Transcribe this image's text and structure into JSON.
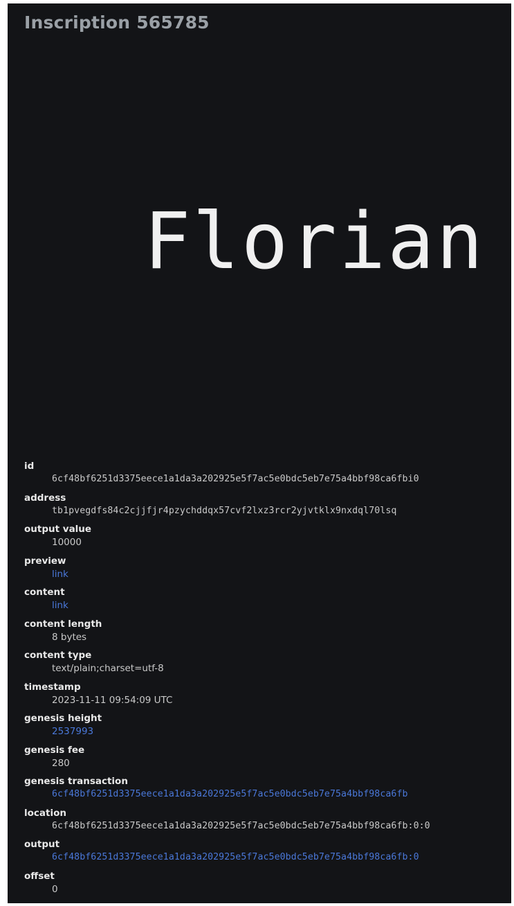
{
  "title": "Inscription 565785",
  "preview": {
    "content": "Florian"
  },
  "details": {
    "id": {
      "label": "id",
      "value": "6cf48bf6251d3375eece1a1da3a202925e5f7ac5e0bdc5eb7e75a4bbf98ca6fbi0"
    },
    "address": {
      "label": "address",
      "value": "tb1pvegdfs84c2cjjfjr4pzychddqx57cvf2lxz3rcr2yjvtklx9nxdql70lsq"
    },
    "output_value": {
      "label": "output value",
      "value": "10000"
    },
    "preview": {
      "label": "preview",
      "link_text": "link"
    },
    "content": {
      "label": "content",
      "link_text": "link"
    },
    "content_length": {
      "label": "content length",
      "value": "8 bytes"
    },
    "content_type": {
      "label": "content type",
      "value": "text/plain;charset=utf-8"
    },
    "timestamp": {
      "label": "timestamp",
      "value": "2023-11-11 09:54:09 UTC"
    },
    "genesis_height": {
      "label": "genesis height",
      "link_text": "2537993"
    },
    "genesis_fee": {
      "label": "genesis fee",
      "value": "280"
    },
    "genesis_transaction": {
      "label": "genesis transaction",
      "link_text": "6cf48bf6251d3375eece1a1da3a202925e5f7ac5e0bdc5eb7e75a4bbf98ca6fb"
    },
    "location": {
      "label": "location",
      "value": "6cf48bf6251d3375eece1a1da3a202925e5f7ac5e0bdc5eb7e75a4bbf98ca6fb:0:0"
    },
    "output": {
      "label": "output",
      "link_text": "6cf48bf6251d3375eece1a1da3a202925e5f7ac5e0bdc5eb7e75a4bbf98ca6fb:0"
    },
    "offset": {
      "label": "offset",
      "value": "0"
    }
  },
  "colors": {
    "background": "#131417",
    "title": "#9aa0a6",
    "text": "#c9c9c9",
    "label": "#e8e8e8",
    "link": "#4a78d9"
  }
}
